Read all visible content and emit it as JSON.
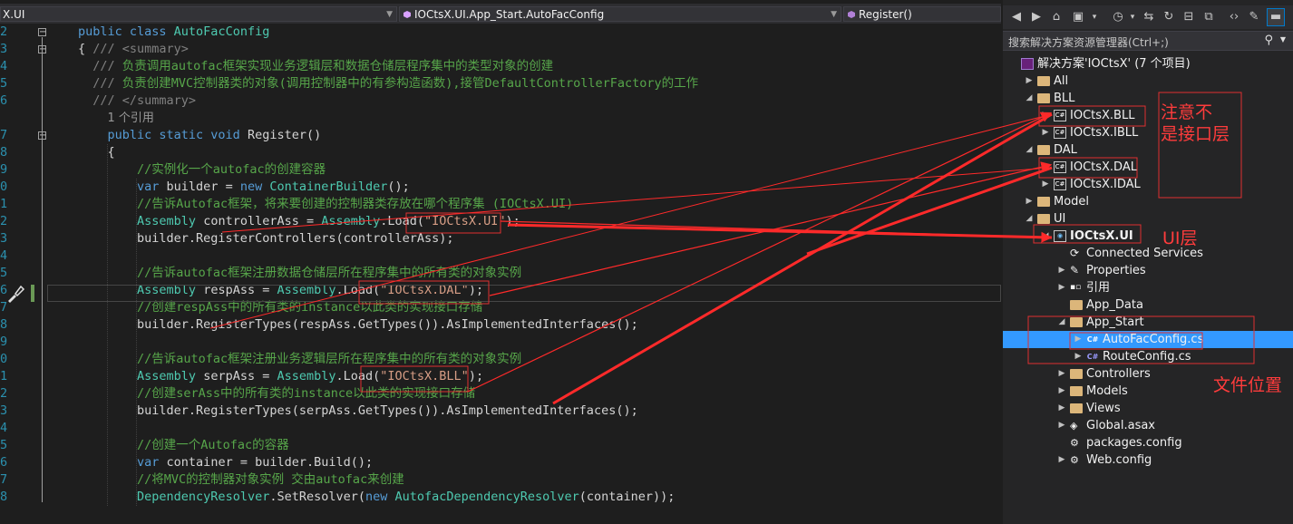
{
  "editor": {
    "nav": {
      "project": "X.UI",
      "type": "IOCtsX.UI.App_Start.AutoFacConfig",
      "member": "Register()"
    },
    "lines": [
      {
        "ln": "2",
        "html": "<span class='kw'>public class </span><span class='ty'>AutoFacConfig</span>"
      },
      {
        "ln": "3",
        "html": "{ <span class='xd'>/// &lt;summary&gt;</span>"
      },
      {
        "ln": "4",
        "html": "  <span class='xd'>/// </span><span class='cm'>负责调用autofac框架实现业务逻辑层和数据仓储层程序集中的类型对象的创建</span>"
      },
      {
        "ln": "5",
        "html": "  <span class='xd'>/// </span><span class='cm'>负责创建MVC控制器类的对象(调用控制器中的有参构造函数),接管DefaultControllerFactory的工作</span>"
      },
      {
        "ln": "6",
        "html": "  <span class='xd'>/// &lt;/summary&gt;</span>"
      },
      {
        "ln": "",
        "html": "    <span class='ref'>1 个引用</span>"
      },
      {
        "ln": "7",
        "html": "    <span class='kw'>public static void </span>Register()"
      },
      {
        "ln": "8",
        "html": "    {"
      },
      {
        "ln": "9",
        "html": "        <span class='cm'>//实例化一个autofac的创建容器</span>"
      },
      {
        "ln": "0",
        "html": "        <span class='kw'>var </span>builder = <span class='kw'>new </span><span class='ty'>ContainerBuilder</span>();"
      },
      {
        "ln": "1",
        "html": "        <span class='cm'>//告诉Autofac框架，将来要创建的控制器类存放在哪个程序集 (IOCtsX.UI)</span>"
      },
      {
        "ln": "2",
        "html": "        <span class='ty'>Assembly </span>controllerAss = <span class='ty'>Assembly</span>.Load(<span class='st'>\"IOCtsX.UI\"</span>);"
      },
      {
        "ln": "3",
        "html": "        builder.RegisterControllers(controllerAss);"
      },
      {
        "ln": "4",
        "html": ""
      },
      {
        "ln": "5",
        "html": "        <span class='cm'>//告诉autofac框架注册数据仓储层所在程序集中的所有类的对象实例</span>"
      },
      {
        "ln": "6",
        "html": "        <span class='ty'>Assembly </span>respAss = <span class='ty'>Assembly</span>.Load(<span class='st'>\"IOCtsX.DAL\"</span>);"
      },
      {
        "ln": "7",
        "html": "        <span class='cm'>//创建respAss中的所有类的instance以此类的实现接口存储</span>"
      },
      {
        "ln": "8",
        "html": "        builder.RegisterTypes(respAss.GetTypes()).AsImplementedInterfaces();"
      },
      {
        "ln": "9",
        "html": ""
      },
      {
        "ln": "0",
        "html": "        <span class='cm'>//告诉autofac框架注册业务逻辑层所在程序集中的所有类的对象实例</span>"
      },
      {
        "ln": "1",
        "html": "        <span class='ty'>Assembly </span>serpAss = <span class='ty'>Assembly</span>.Load(<span class='st'>\"IOCtsX.BLL\"</span>);"
      },
      {
        "ln": "2",
        "html": "        <span class='cm'>//创建serAss中的所有类的instance以此类的实现接口存储</span>"
      },
      {
        "ln": "3",
        "html": "        builder.RegisterTypes(serpAss.GetTypes()).AsImplementedInterfaces();"
      },
      {
        "ln": "4",
        "html": ""
      },
      {
        "ln": "5",
        "html": "        <span class='cm'>//创建一个Autofac的容器</span>"
      },
      {
        "ln": "6",
        "html": "        <span class='kw'>var </span>container = builder.Build();"
      },
      {
        "ln": "7",
        "html": "        <span class='cm'>//将MVC的控制器对象实例 交由autofac来创建</span>"
      },
      {
        "ln": "8",
        "html": "        <span class='ty'>DependencyResolver</span>.SetResolver(<span class='kw'>new </span><span class='ty'>AutofacDependencyResolver</span>(container));"
      }
    ]
  },
  "solution": {
    "search_placeholder": "搜索解决方案资源管理器(Ctrl+;)",
    "nodes": [
      {
        "label": "解决方案'IOCtsX' (7 个项目)",
        "indent": 0,
        "exp": "",
        "icon": "solution-icon",
        "bold": false
      },
      {
        "label": "All",
        "indent": 1,
        "exp": "▶",
        "icon": "folder-icon"
      },
      {
        "label": "BLL",
        "indent": 1,
        "exp": "◢",
        "icon": "folder-icon"
      },
      {
        "label": "IOCtsX.BLL",
        "indent": 2,
        "exp": "▶",
        "icon": "project-icon"
      },
      {
        "label": "IOCtsX.IBLL",
        "indent": 2,
        "exp": "▶",
        "icon": "project-icon"
      },
      {
        "label": "DAL",
        "indent": 1,
        "exp": "◢",
        "icon": "folder-icon"
      },
      {
        "label": "IOCtsX.DAL",
        "indent": 2,
        "exp": "▶",
        "icon": "project-icon"
      },
      {
        "label": "IOCtsX.IDAL",
        "indent": 2,
        "exp": "▶",
        "icon": "project-icon"
      },
      {
        "label": "Model",
        "indent": 1,
        "exp": "▶",
        "icon": "folder-icon"
      },
      {
        "label": "UI",
        "indent": 1,
        "exp": "◢",
        "icon": "folder-icon"
      },
      {
        "label": "IOCtsX.UI",
        "indent": 2,
        "exp": "◢",
        "icon": "web-project-icon",
        "bold": true
      },
      {
        "label": "Connected Services",
        "indent": 3,
        "exp": "",
        "icon": "connected-services-icon"
      },
      {
        "label": "Properties",
        "indent": 3,
        "exp": "▶",
        "icon": "wrench-icon"
      },
      {
        "label": "引用",
        "indent": 3,
        "exp": "▶",
        "icon": "references-icon"
      },
      {
        "label": "App_Data",
        "indent": 3,
        "exp": "",
        "icon": "folder-icon"
      },
      {
        "label": "App_Start",
        "indent": 3,
        "exp": "◢",
        "icon": "folder-icon"
      },
      {
        "label": "AutoFacConfig.cs",
        "indent": 4,
        "exp": "▶",
        "icon": "csharp-file-icon",
        "selected": true
      },
      {
        "label": "RouteConfig.cs",
        "indent": 4,
        "exp": "▶",
        "icon": "csharp-file-icon"
      },
      {
        "label": "Controllers",
        "indent": 3,
        "exp": "▶",
        "icon": "folder-icon"
      },
      {
        "label": "Models",
        "indent": 3,
        "exp": "▶",
        "icon": "folder-icon"
      },
      {
        "label": "Views",
        "indent": 3,
        "exp": "▶",
        "icon": "folder-icon"
      },
      {
        "label": "Global.asax",
        "indent": 3,
        "exp": "▶",
        "icon": "global-asax-icon"
      },
      {
        "label": "packages.config",
        "indent": 3,
        "exp": "",
        "icon": "config-file-icon"
      },
      {
        "label": "Web.config",
        "indent": 3,
        "exp": "▶",
        "icon": "config-file-icon"
      }
    ]
  },
  "annotations": {
    "not_interface": "注意不\n是接口层",
    "ui_layer": "UI层",
    "file_location": "文件位置"
  },
  "colors": {
    "accent": "#007acc",
    "selection": "#3399ff",
    "annotation": "#ff2a2a"
  }
}
